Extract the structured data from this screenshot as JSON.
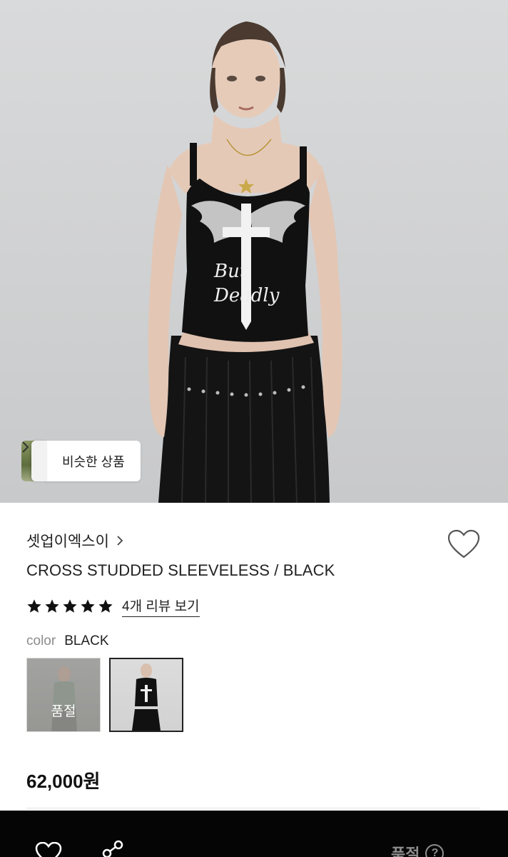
{
  "hero": {
    "similar_button_label": "비슷한 상품"
  },
  "product": {
    "brand": "셋업이엑스이",
    "title": "CROSS STUDDED SLEEVELESS / BLACK",
    "rating": 5,
    "review_link": "4개 리뷰 보기",
    "price": "62,000원"
  },
  "color": {
    "label": "color",
    "selected": "BLACK",
    "swatches": [
      {
        "name": "sage",
        "status": "품절",
        "selected": false
      },
      {
        "name": "black",
        "status": "",
        "selected": true
      }
    ]
  },
  "bottom_bar": {
    "status_label": "품절",
    "help_symbol": "?"
  },
  "icons": {
    "brand_chevron": "chevron-right-icon",
    "wish": "heart-outline-icon",
    "share": "share-icon",
    "help": "question-circle-icon"
  },
  "colors": {
    "accent": "#111111",
    "bottom_bar_bg": "#050505",
    "muted_text": "#8c8c8c"
  }
}
